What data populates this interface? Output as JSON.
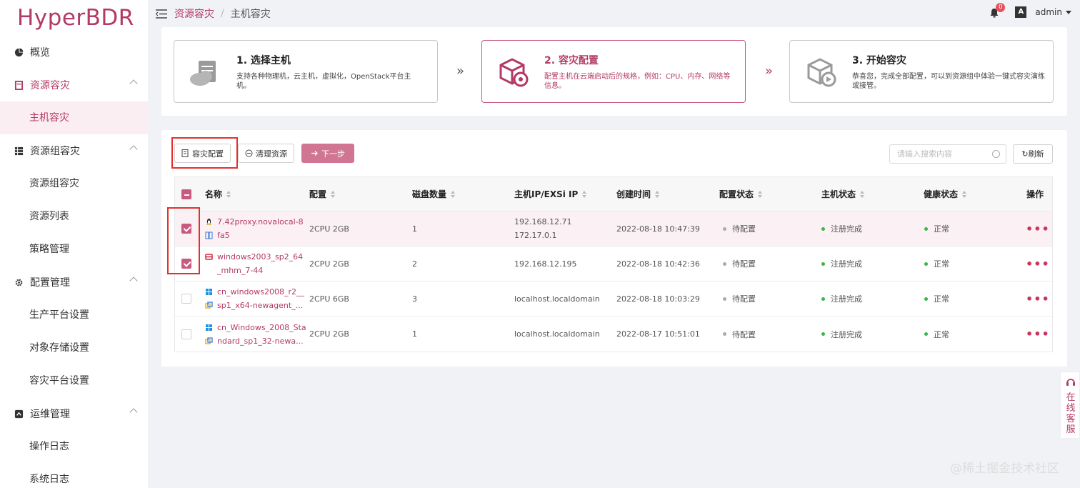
{
  "app": {
    "logo": "HyperBDR"
  },
  "sidebar": {
    "items": [
      {
        "label": "概览",
        "icon": "dashboard-icon",
        "type": "item"
      },
      {
        "label": "资源容灾",
        "icon": "server-icon",
        "type": "parent",
        "expanded": true,
        "active": true
      },
      {
        "label": "主机容灾",
        "type": "sub",
        "active": true
      },
      {
        "label": "资源组容灾",
        "icon": "group-icon",
        "type": "parent",
        "expanded": true
      },
      {
        "label": "资源组容灾",
        "type": "sub"
      },
      {
        "label": "资源列表",
        "type": "sub"
      },
      {
        "label": "策略管理",
        "type": "sub"
      },
      {
        "label": "配置管理",
        "icon": "gear-icon",
        "type": "parent",
        "expanded": true
      },
      {
        "label": "生产平台设置",
        "type": "sub"
      },
      {
        "label": "对象存储设置",
        "type": "sub"
      },
      {
        "label": "容灾平台设置",
        "type": "sub"
      },
      {
        "label": "运维管理",
        "icon": "ops-icon",
        "type": "parent",
        "expanded": true
      },
      {
        "label": "操作日志",
        "type": "sub"
      },
      {
        "label": "系统日志",
        "type": "sub"
      }
    ]
  },
  "header": {
    "breadcrumb": [
      "资源容灾",
      "主机容灾"
    ],
    "separator": "/",
    "notifications": "0",
    "lang_icon": "A",
    "user": "admin"
  },
  "steps": [
    {
      "title": "1. 选择主机",
      "desc": "支持各种物理机，云主机，虚拟化，OpenStack平台主机。",
      "active": false
    },
    {
      "title": "2. 容灾配置",
      "desc": "配置主机在云端启动后的规格，例如：CPU、内存、网络等信息。",
      "active": true
    },
    {
      "title": "3. 开始容灾",
      "desc": "恭喜您，完成全部配置，可以到资源组中体验一键式容灾演练或接管。",
      "active": false
    }
  ],
  "step_arrow": "»",
  "toolbar": {
    "config_label": "容灾配置",
    "clean_label": "清理资源",
    "next_label": "下一步",
    "search_placeholder": "请输入搜索内容",
    "refresh_label": "刷新"
  },
  "table": {
    "columns": [
      "名称",
      "配置",
      "磁盘数量",
      "主机IP/EXSi IP",
      "创建时间",
      "配置状态",
      "主机状态",
      "健康状态",
      "操作"
    ],
    "rows": [
      {
        "checked": true,
        "os": "linux",
        "name1": "7.42proxy.novalocal-8",
        "name2": "fa5",
        "config": "2CPU 2GB",
        "disks": "1",
        "ip1": "192.168.12.71",
        "ip2": "172.17.0.1",
        "created": "2022-08-18 10:47:39",
        "cfg_status": "待配置",
        "host_status": "注册完成",
        "health": "正常",
        "ops": "•••"
      },
      {
        "checked": true,
        "os": "redhat",
        "name1": "windows2003_sp2_64",
        "name2": "_mhm_7-44",
        "config": "2CPU 2GB",
        "disks": "2",
        "ip1": "192.168.12.195",
        "ip2": "",
        "created": "2022-08-18 10:42:36",
        "cfg_status": "待配置",
        "host_status": "注册完成",
        "health": "正常",
        "ops": "•••"
      },
      {
        "checked": false,
        "os": "windows",
        "name1": "cn_windows2008_r2__",
        "name2": "sp1_x64-newagent_...",
        "config": "2CPU 6GB",
        "disks": "3",
        "ip1": "localhost.localdomain",
        "ip2": "",
        "created": "2022-08-18 10:03:29",
        "cfg_status": "待配置",
        "host_status": "注册完成",
        "health": "正常",
        "ops": "•••"
      },
      {
        "checked": false,
        "os": "windows",
        "name1": "cn_Windows_2008_Sta",
        "name2": "ndard_sp1_32-newa...",
        "config": "2CPU 2GB",
        "disks": "1",
        "ip1": "localhost.localdomain",
        "ip2": "",
        "created": "2022-08-17 10:51:01",
        "cfg_status": "待配置",
        "host_status": "注册完成",
        "health": "正常",
        "ops": "•••"
      }
    ]
  },
  "float_service": "在线客服",
  "watermark": "@稀土掘金技术社区",
  "colors": {
    "brand": "#b33a66",
    "primary_button": "#d07592",
    "highlight_box": "#e62e2e",
    "ok_dot": "#3bb54a"
  }
}
